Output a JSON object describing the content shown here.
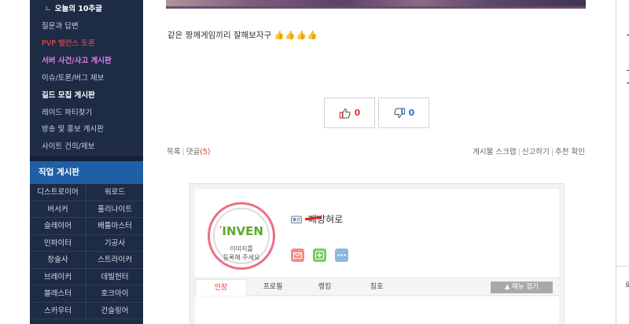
{
  "sidebar": {
    "menu": [
      {
        "label": "오늘의 10추글",
        "style": "sub"
      },
      {
        "label": "질문과 답변",
        "style": "normal"
      },
      {
        "label": "PVP 밸런스 토론",
        "style": "red"
      },
      {
        "label": "서버 사건/사고 게시판",
        "style": "pink"
      },
      {
        "label": "이슈/토론/버그 제보",
        "style": "normal"
      },
      {
        "label": "길드 모집 게시판",
        "style": "bright"
      },
      {
        "label": "레이드 파티찾기",
        "style": "normal"
      },
      {
        "label": "방송 및 홍보 게시판",
        "style": "normal"
      },
      {
        "label": "사이트 건의/제보",
        "style": "normal"
      }
    ],
    "sub_arrow": "ㄴ",
    "job_header": "직업 게시판",
    "jobs": [
      [
        "디스트로이어",
        "워로드"
      ],
      [
        "버서커",
        "홀리나이트"
      ],
      [
        "슬레이어",
        "배틀마스터"
      ],
      [
        "인파이터",
        "기공사"
      ],
      [
        "창술사",
        "스트라이커"
      ],
      [
        "브레이커",
        "데빌헌터"
      ],
      [
        "블래스터",
        "호크아이"
      ],
      [
        "스카우터",
        "건슬링어"
      ]
    ]
  },
  "post": {
    "text": "같은 짱께게임끼리 잘해보자구",
    "emoji": "👍👍👍👍"
  },
  "vote": {
    "up_count": "0",
    "down_count": "0"
  },
  "links": {
    "list": "목록",
    "comments": "댓글",
    "comment_count": "(5)",
    "scrap": "게시물 스크랩",
    "report": "신고하기",
    "recommend": "추천 확인"
  },
  "profile": {
    "logo": "INVEN",
    "avatar_line1": "이미지를",
    "avatar_line2": "등록해 주세요",
    "username": "패방혀로",
    "tabs": [
      "인장",
      "프로필",
      "랭킹",
      "칭호"
    ],
    "menu_toggle": "▲ 메뉴 접기"
  },
  "right_panel": {
    "char": "로"
  },
  "colors": {
    "sidebar_bg": "#1e2b45",
    "job_header_bg": "#1f5fa5",
    "accent_red": "#e0392e",
    "accent_pink": "#ea7bf2",
    "vote_down_blue": "#2b6fd0"
  }
}
